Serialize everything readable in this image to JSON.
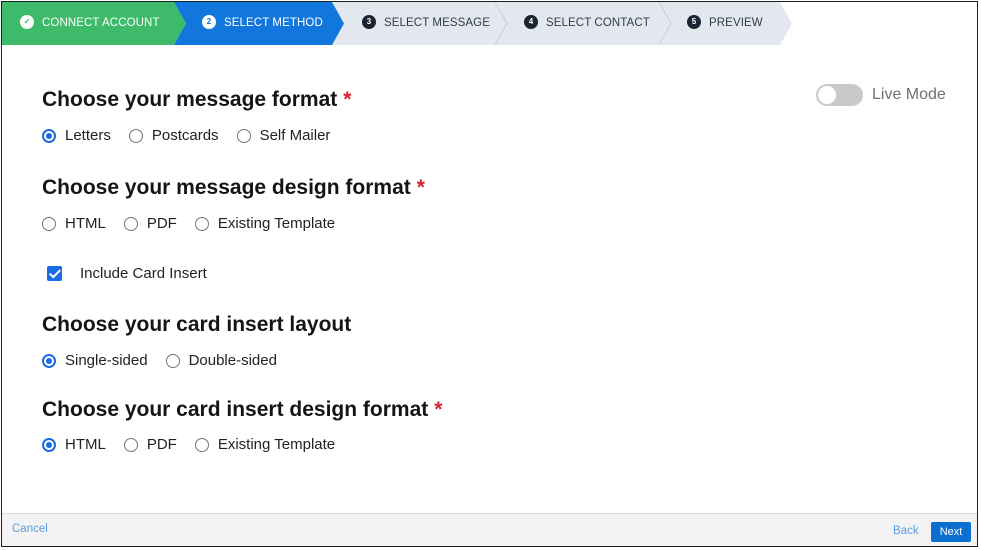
{
  "steps": [
    {
      "label": "CONNECT ACCOUNT",
      "number": "✓",
      "state": "complete"
    },
    {
      "label": "SELECT METHOD",
      "number": "2",
      "state": "active"
    },
    {
      "label": "SELECT MESSAGE",
      "number": "3",
      "state": "pending"
    },
    {
      "label": "SELECT CONTACT",
      "number": "4",
      "state": "pending"
    },
    {
      "label": "PREVIEW",
      "number": "5",
      "state": "pending"
    }
  ],
  "colors": {
    "complete": "#3dba6a",
    "active": "#1177dd",
    "pending": "#e3e8ee",
    "required": "#d9202e",
    "accent": "#1b6ae6"
  },
  "live_mode": {
    "label": "Live Mode",
    "enabled": false
  },
  "message_format": {
    "title": "Choose your message format",
    "required": "*",
    "options": [
      "Letters",
      "Postcards",
      "Self Mailer"
    ],
    "selected": "Letters"
  },
  "design_format": {
    "title": "Choose your message design format",
    "required": "*",
    "options": [
      "HTML",
      "PDF",
      "Existing Template"
    ],
    "selected": ""
  },
  "card_insert": {
    "label": "Include Card Insert",
    "checked": true
  },
  "insert_layout": {
    "title": "Choose your card insert layout",
    "options": [
      "Single-sided",
      "Double-sided"
    ],
    "selected": "Single-sided"
  },
  "insert_design": {
    "title": "Choose your card insert design format",
    "required": "*",
    "options": [
      "HTML",
      "PDF",
      "Existing Template"
    ],
    "selected": "HTML"
  },
  "footer": {
    "cancel": "Cancel",
    "back": "Back",
    "next": "Next"
  }
}
